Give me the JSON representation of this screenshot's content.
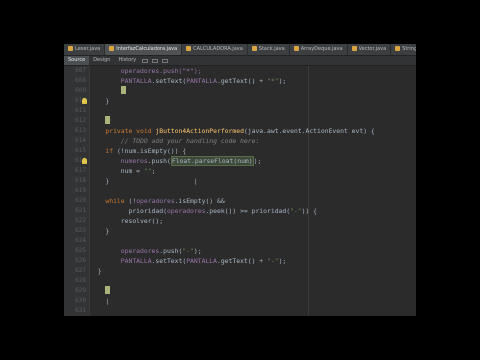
{
  "tabs": [
    {
      "label": "Lexer.java",
      "active": false
    },
    {
      "label": "InterfazCalculadora.java",
      "active": true
    },
    {
      "label": "CALCULADORA.java",
      "active": false
    },
    {
      "label": "Stack.java",
      "active": false
    },
    {
      "label": "ArrayDeque.java",
      "active": false
    },
    {
      "label": "Vector.java",
      "active": false
    },
    {
      "label": "String.java",
      "active": false
    }
  ],
  "toolbar": {
    "source_label": "Source",
    "design_label": "Design",
    "history_label": "History"
  },
  "editor": {
    "line_numbers": [
      "607",
      "608",
      "609",
      "610",
      "611",
      "612",
      "613",
      "614",
      "615",
      "616",
      "617",
      "618",
      "619",
      "620",
      "621",
      "622",
      "623",
      "624",
      "625",
      "626",
      "627",
      "628",
      "629",
      "630",
      "631"
    ],
    "lines": [
      {
        "segments": [
          {
            "t": "        operadores.push(\"*\");",
            "c": "fld"
          }
        ]
      },
      {
        "segments": [
          {
            "t": "        PANTALLA",
            "c": "fld"
          },
          {
            "t": ".setText(",
            "c": ""
          },
          {
            "t": "PANTALLA",
            "c": "fld"
          },
          {
            "t": ".getText() + ",
            "c": ""
          },
          {
            "t": "\"*\"",
            "c": "str"
          },
          {
            "t": ");",
            "c": ""
          }
        ]
      },
      {
        "segments": [
          {
            "t": "        ",
            "c": ""
          }
        ],
        "caret": true
      },
      {
        "segments": [
          {
            "t": "    }",
            "c": ""
          }
        ]
      },
      {
        "segments": [
          {
            "t": "",
            "c": ""
          }
        ]
      },
      {
        "segments": [
          {
            "t": "    ",
            "c": ""
          }
        ],
        "caret": true
      },
      {
        "segments": [
          {
            "t": "    private void ",
            "c": "kw"
          },
          {
            "t": "jButton4ActionPerformed",
            "c": "fn"
          },
          {
            "t": "(java.awt.event.ActionEvent evt) {",
            "c": ""
          }
        ]
      },
      {
        "segments": [
          {
            "t": "        // TODO add your handling code here:",
            "c": "cm"
          }
        ]
      },
      {
        "segments": [
          {
            "t": "    if ",
            "c": "kw"
          },
          {
            "t": "(!num.isEmpty()) {",
            "c": ""
          }
        ]
      },
      {
        "segments": [
          {
            "t": "        ",
            "c": ""
          },
          {
            "t": "numeros",
            "c": "fld"
          },
          {
            "t": ".push(",
            "c": ""
          },
          {
            "t": "Float.parseFloat(num)",
            "c": "hl"
          },
          {
            "t": ");",
            "c": ""
          }
        ]
      },
      {
        "segments": [
          {
            "t": "        num = ",
            "c": ""
          },
          {
            "t": "\"\"",
            "c": "str"
          },
          {
            "t": ";",
            "c": ""
          }
        ]
      },
      {
        "segments": [
          {
            "t": "    }",
            "c": ""
          },
          {
            "t": "                      |",
            "c": ""
          }
        ]
      },
      {
        "segments": [
          {
            "t": "",
            "c": ""
          }
        ]
      },
      {
        "segments": [
          {
            "t": "    while ",
            "c": "kw"
          },
          {
            "t": "(!",
            "c": ""
          },
          {
            "t": "operadores",
            "c": "fld"
          },
          {
            "t": ".isEmpty() &&",
            "c": ""
          }
        ]
      },
      {
        "segments": [
          {
            "t": "          prioridad(",
            "c": ""
          },
          {
            "t": "operadores",
            "c": "fld"
          },
          {
            "t": ".peek()) >= prioridad(",
            "c": ""
          },
          {
            "t": "\"-\"",
            "c": "str"
          },
          {
            "t": ")) {",
            "c": ""
          }
        ]
      },
      {
        "segments": [
          {
            "t": "        resolver();",
            "c": ""
          }
        ]
      },
      {
        "segments": [
          {
            "t": "    }",
            "c": ""
          }
        ]
      },
      {
        "segments": [
          {
            "t": "",
            "c": ""
          }
        ]
      },
      {
        "segments": [
          {
            "t": "        ",
            "c": ""
          },
          {
            "t": "operadores",
            "c": "fld"
          },
          {
            "t": ".push(",
            "c": ""
          },
          {
            "t": "\"-\"",
            "c": "str"
          },
          {
            "t": ");",
            "c": ""
          }
        ]
      },
      {
        "segments": [
          {
            "t": "        PANTALLA",
            "c": "fld"
          },
          {
            "t": ".setText(",
            "c": ""
          },
          {
            "t": "PANTALLA",
            "c": "fld"
          },
          {
            "t": ".getText() + ",
            "c": ""
          },
          {
            "t": "\"-\"",
            "c": "str"
          },
          {
            "t": ");",
            "c": ""
          }
        ]
      },
      {
        "segments": [
          {
            "t": "  }",
            "c": ""
          }
        ]
      },
      {
        "segments": [
          {
            "t": "",
            "c": ""
          }
        ]
      },
      {
        "segments": [
          {
            "t": "    ",
            "c": ""
          }
        ],
        "caret": true
      },
      {
        "segments": [
          {
            "t": "    |",
            "c": ""
          }
        ]
      },
      {
        "segments": [
          {
            "t": "",
            "c": ""
          }
        ]
      }
    ],
    "bulb_rows": [
      3,
      9
    ],
    "colors": {
      "background": "#2b2b2b",
      "keyword": "#cc7832",
      "method": "#ffc66d",
      "field": "#9876aa",
      "string": "#6a8759",
      "comment": "#808080",
      "caret": "#a9b37a"
    }
  }
}
